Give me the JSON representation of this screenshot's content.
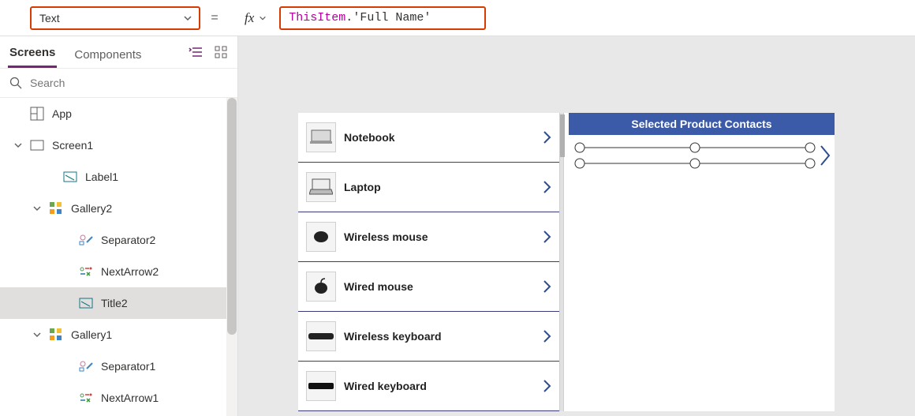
{
  "formula_bar": {
    "property": "Text",
    "equals": "=",
    "fx_label": "fx",
    "formula_tokens": {
      "this": "ThisItem",
      "dot": ".",
      "lit": "'Full Name'"
    }
  },
  "left_panel": {
    "tabs": {
      "screens": "Screens",
      "components": "Components"
    },
    "search_placeholder": "Search",
    "tree": {
      "app": "App",
      "screen1": "Screen1",
      "label1": "Label1",
      "gallery2": "Gallery2",
      "separator2": "Separator2",
      "nextarrow2": "NextArrow2",
      "title2": "Title2",
      "gallery1": "Gallery1",
      "separator1": "Separator1",
      "nextarrow1": "NextArrow1"
    }
  },
  "canvas": {
    "header_right": "Selected Product Contacts",
    "products": [
      {
        "name": "Notebook"
      },
      {
        "name": "Laptop"
      },
      {
        "name": "Wireless mouse"
      },
      {
        "name": "Wired mouse"
      },
      {
        "name": "Wireless keyboard"
      },
      {
        "name": "Wired keyboard"
      }
    ]
  }
}
